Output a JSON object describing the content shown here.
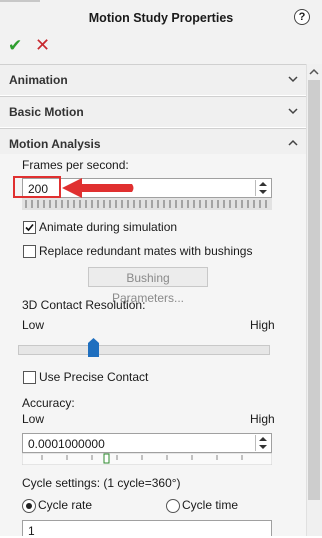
{
  "title": "Motion Study Properties",
  "toolbar": {
    "ok_icon": "checkmark-icon",
    "cancel_icon": "x-icon"
  },
  "sections": {
    "animation": "Animation",
    "basic_motion": "Basic Motion",
    "motion_analysis": "Motion Analysis"
  },
  "fps": {
    "label": "Frames per second:",
    "value": "200"
  },
  "animate": {
    "label": "Animate during simulation",
    "checked": true
  },
  "replace": {
    "label": "Replace redundant mates with bushings",
    "checked": false
  },
  "bushing_button": "Bushing Parameters...",
  "contact": {
    "label": "3D Contact Resolution:",
    "low": "Low",
    "high": "High",
    "level": 0.3
  },
  "precise": {
    "label": "Use Precise Contact",
    "checked": false
  },
  "accuracy": {
    "label": "Accuracy:",
    "low": "Low",
    "high": "High",
    "value": "0.0001000000"
  },
  "cycle": {
    "label": "Cycle settings: (1 cycle=360°)",
    "rate_label": "Cycle rate",
    "time_label": "Cycle time",
    "selected": "rate",
    "value": "1"
  },
  "colors": {
    "accent_red": "#e03030",
    "ok_green": "#2e9e2e",
    "slider_blue": "#1f6fbf"
  }
}
